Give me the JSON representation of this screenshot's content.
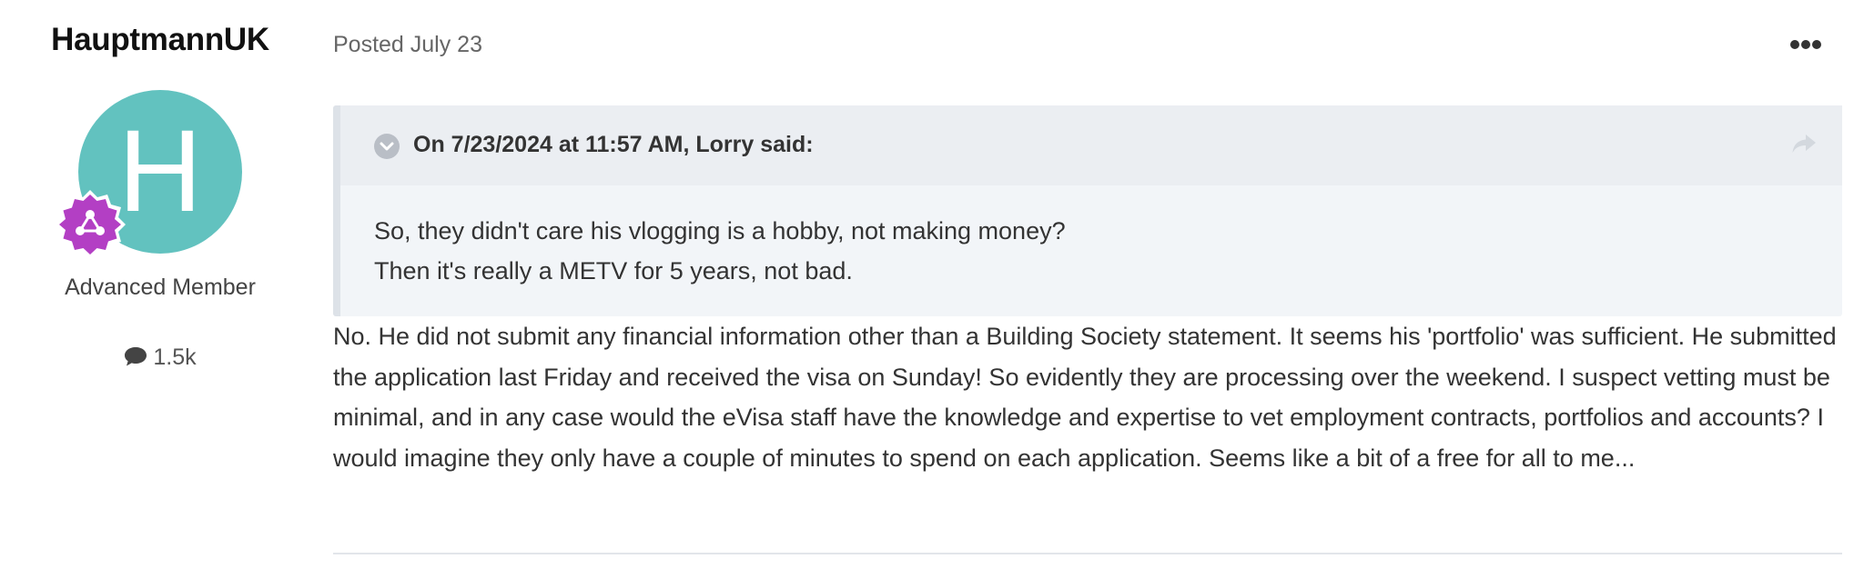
{
  "author": {
    "name": "HauptmannUK",
    "avatar_letter": "H",
    "avatar_color": "#62c2bf",
    "badge_icon": "share-network-badge-icon",
    "badge_color": "#b33fc4",
    "member_title": "Advanced Member",
    "post_count": "1.5k",
    "post_count_icon": "speech-bubble-icon"
  },
  "post": {
    "date": "Posted July 23",
    "menu_icon": "ellipsis-icon",
    "quote": {
      "citation": "On 7/23/2024 at 11:57 AM, Lorry said:",
      "toggle_icon": "chevron-down-circle-icon",
      "share_icon": "share-arrow-icon",
      "lines": [
        "So, they didn't care his vlogging is a hobby, not making money?",
        "Then it's really a METV for 5 years,  not bad."
      ]
    },
    "body": "No. He did not submit any financial information other than a Building Society statement. It seems his 'portfolio' was sufficient. He submitted the application last Friday and received the visa on Sunday!  So evidently they are processing over the weekend. I suspect vetting must be minimal, and in any case would the eVisa staff have the knowledge and expertise to vet employment contracts, portfolios and accounts? I would imagine they only have a couple of minutes to spend on each application.  Seems like a bit of a free for all to me..."
  }
}
